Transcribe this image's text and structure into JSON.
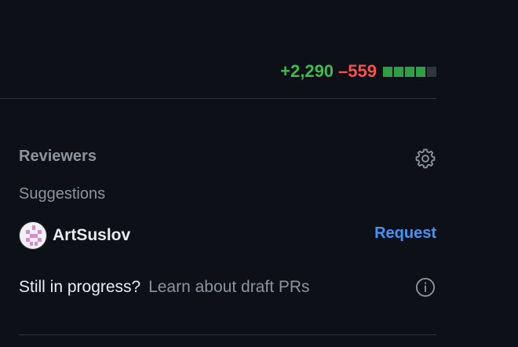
{
  "diffstat": {
    "additions": "+2,290",
    "deletions": "–559",
    "blocks": [
      "added",
      "added",
      "added",
      "added",
      "neutral"
    ]
  },
  "reviewers": {
    "title": "Reviewers",
    "settings_icon": "gear-icon",
    "suggestions_label": "Suggestions",
    "suggested": [
      {
        "name": "ArtSuslov",
        "action_label": "Request"
      }
    ]
  },
  "draft": {
    "question": "Still in progress?",
    "link": "Learn about draft PRs",
    "icon": "info-icon"
  },
  "colors": {
    "background": "#0d1117",
    "additions": "#3fb950",
    "deletions": "#f85149",
    "link": "#4493f8",
    "muted": "#8b949e",
    "text": "#e6edf3",
    "border": "#30363d"
  }
}
